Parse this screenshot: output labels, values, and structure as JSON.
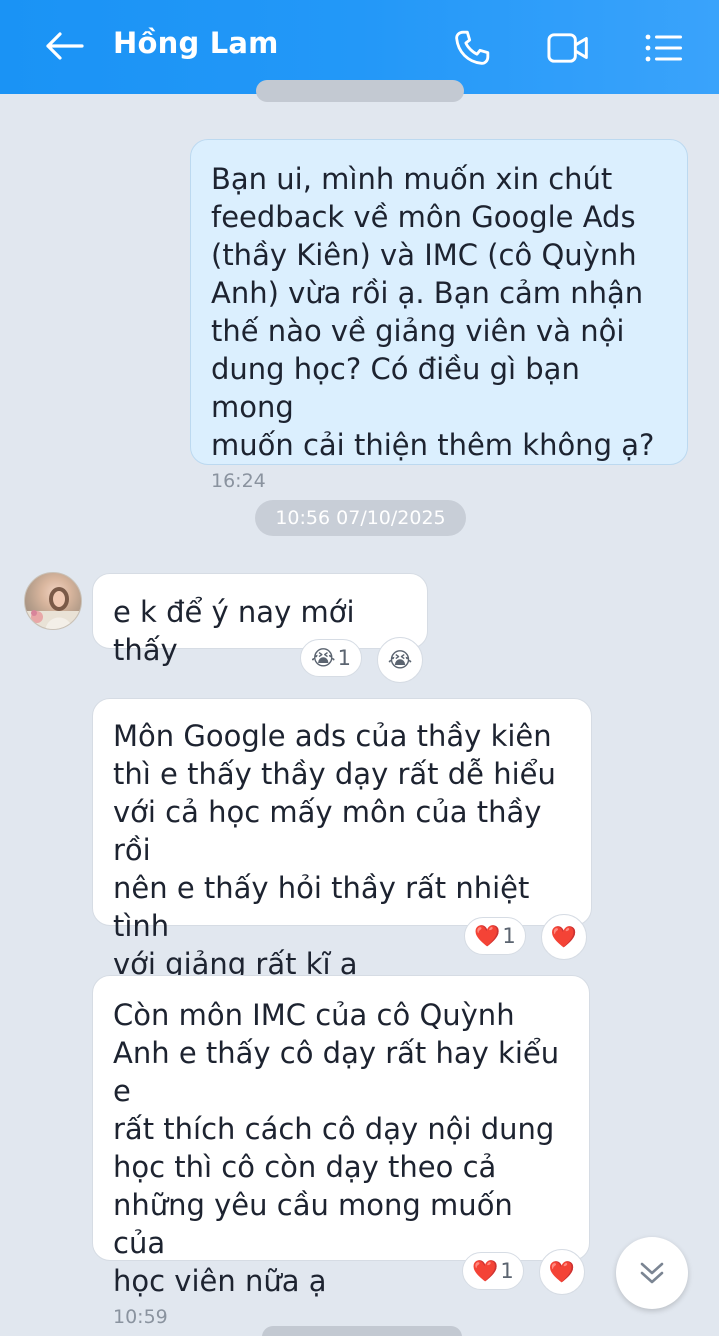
{
  "header": {
    "contact_name": "Hồng Lam",
    "back_icon": "arrow-left-icon",
    "call_icon": "phone-icon",
    "video_icon": "video-camera-icon",
    "menu_icon": "list-menu-icon"
  },
  "messages": [
    {
      "sender": "me",
      "text": "Bạn ui, mình muốn xin chút\nfeedback về môn Google Ads\n(thầy Kiên) và IMC (cô Quỳnh\nAnh) vừa rồi ạ. Bạn cảm nhận\nthế nào về giảng viên và nội\ndung học? Có điều gì bạn mong\nmuốn cải thiện thêm không ạ?",
      "time": "16:24"
    },
    {
      "sender": "them",
      "text": "e k để ý nay mới thấy",
      "reactions": [
        {
          "emoji": "😭",
          "count": "1"
        },
        {
          "emoji": "😭"
        }
      ]
    },
    {
      "sender": "them",
      "text": "Môn Google ads của thầy kiên\nthì e thấy thầy dạy rất dễ hiểu\nvới cả học mấy môn của thầy rồi\nnên e thấy hỏi thầy rất nhiệt tình\nvới giảng rất kĩ ạ",
      "reactions": [
        {
          "emoji": "❤️",
          "count": "1"
        },
        {
          "emoji": "❤️"
        }
      ]
    },
    {
      "sender": "them",
      "text": "Còn môn IMC của cô Quỳnh\nAnh e thấy cô dạy rất hay kiểu e\nrất thích cách cô dạy nội dung\nhọc thì cô còn dạy theo cả\nnhững yêu cầu mong muốn của\nhọc viên nữa ạ",
      "time": "10:59",
      "reactions": [
        {
          "emoji": "❤️",
          "count": "1"
        },
        {
          "emoji": "❤️"
        }
      ]
    }
  ],
  "date_separator": "10:56 07/10/2025",
  "scroll_button_icon": "double-chevron-down-icon",
  "colors": {
    "header_blue": "#2398f8",
    "outgoing_bubble": "#dbeffe",
    "incoming_bubble": "#ffffff",
    "background": "#e1e7ef",
    "heart_red": "#e5223a"
  }
}
